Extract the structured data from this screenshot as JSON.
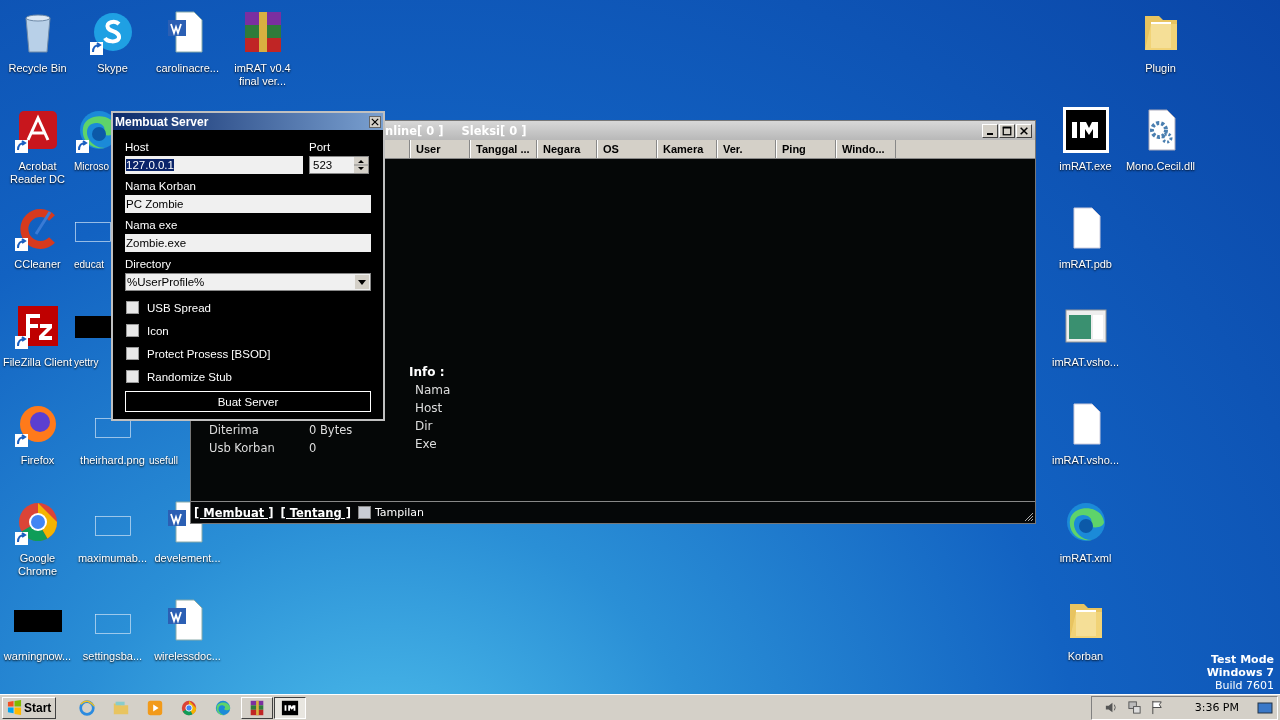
{
  "desktop": {
    "left_icons": [
      {
        "label": "Recycle Bin",
        "kind": "recycle"
      },
      {
        "label": "Acrobat Reader DC",
        "kind": "acrobat",
        "shortcut": true
      },
      {
        "label": "CCleaner",
        "kind": "ccleaner",
        "shortcut": true
      },
      {
        "label": "FileZilla Client",
        "kind": "filezilla",
        "shortcut": true
      },
      {
        "label": "Firefox",
        "kind": "firefox",
        "shortcut": true
      },
      {
        "label": "Google Chrome",
        "kind": "chrome",
        "shortcut": true
      },
      {
        "label": "warningnow...",
        "kind": "black"
      },
      {
        "label": "Skype",
        "kind": "skype",
        "shortcut": true
      },
      {
        "label": "Microso",
        "kind": "edge",
        "shortcut": true
      },
      {
        "label": "educat",
        "kind": "blank"
      },
      {
        "label": "yettry",
        "kind": "black"
      },
      {
        "label": "theirhard.png",
        "kind": "blank"
      },
      {
        "label": "maximumab...",
        "kind": "blank"
      },
      {
        "label": "settingsba...",
        "kind": "blank"
      },
      {
        "label": "carolinacre...",
        "kind": "word"
      },
      {
        "label": "usefull"
      },
      {
        "label": "develement...",
        "kind": "word"
      },
      {
        "label": "wirelessdoc...",
        "kind": "word"
      },
      {
        "label": "imRAT v0.4 final ver...",
        "kind": "winrar"
      }
    ],
    "right_icons": [
      {
        "label": "Plugin",
        "kind": "folder"
      },
      {
        "label": "imRAT.exe",
        "kind": "im"
      },
      {
        "label": "Mono.Cecil.dll",
        "kind": "gear"
      },
      {
        "label": "imRAT.pdb",
        "kind": "file"
      },
      {
        "label": "imRAT.vsho...",
        "kind": "vshost"
      },
      {
        "label": "imRAT.vsho...",
        "kind": "file"
      },
      {
        "label": "imRAT.xml",
        "kind": "edge"
      },
      {
        "label": "Korban",
        "kind": "folder"
      }
    ],
    "watermark_lines": [
      "Test Mode",
      "Windows 7",
      "Build 7601"
    ]
  },
  "main_window": {
    "title_parts": [
      "nline[ 0 ]",
      "Sleksi[ 0 ]"
    ],
    "columns": [
      "User",
      "Tanggal ...",
      "Negara",
      "OS",
      "Kamera",
      "Ver.",
      "Ping",
      "Windo..."
    ],
    "stats": [
      {
        "label": "Diterima",
        "value": "0 Bytes"
      },
      {
        "label": "Usb Korban",
        "value": "0"
      }
    ],
    "info": {
      "title": "Info :",
      "items": [
        "Nama",
        "Host",
        "Dir",
        "Exe"
      ]
    },
    "footer": {
      "links": [
        "[ Membuat ]",
        "[ Tentang ]"
      ],
      "toggle": {
        "label": "Tampilan",
        "checked": false
      }
    }
  },
  "dialog": {
    "title": "Membuat Server",
    "host": {
      "label": "Host",
      "value": "127.0.0.1",
      "highlighted": true
    },
    "port": {
      "label": "Port",
      "value": "523"
    },
    "victim_name": {
      "label": "Nama Korban",
      "value": "PC Zombie"
    },
    "exe_name": {
      "label": "Nama exe",
      "value": "Zombie.exe"
    },
    "directory": {
      "label": "Directory",
      "value": "%UserProfile%"
    },
    "options": [
      {
        "label": "USB Spread",
        "checked": false
      },
      {
        "label": "Icon",
        "checked": false
      },
      {
        "label": "Protect Prosess [BSOD]",
        "checked": false
      },
      {
        "label": "Randomize Stub",
        "checked": false
      }
    ],
    "button": "Buat Server"
  },
  "taskbar": {
    "start": "Start",
    "items": [
      {
        "kind": "ie",
        "pinned": true,
        "selected": false
      },
      {
        "kind": "explorer",
        "pinned": true,
        "selected": false
      },
      {
        "kind": "media",
        "pinned": true,
        "selected": false
      },
      {
        "kind": "chrome",
        "pinned": true,
        "selected": false
      },
      {
        "kind": "edge",
        "pinned": true,
        "selected": false
      },
      {
        "kind": "winrar",
        "pinned": false,
        "selected": false
      },
      {
        "kind": "im",
        "pinned": false,
        "selected": true
      }
    ],
    "clock": "3:36 PM"
  }
}
